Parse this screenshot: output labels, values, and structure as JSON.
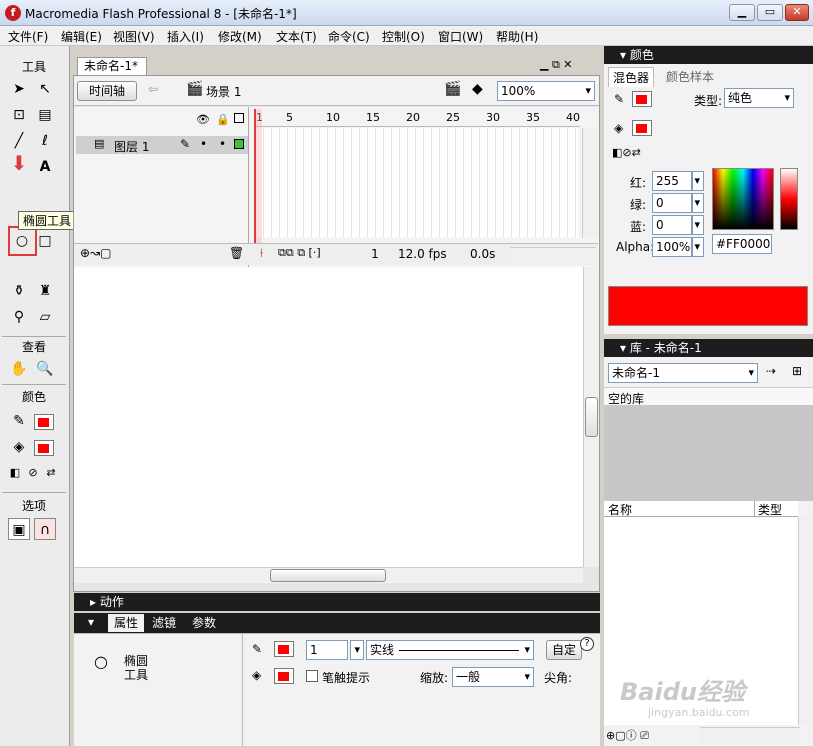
{
  "window": {
    "title": "Macromedia Flash Professional 8 - [未命名-1*]",
    "app_icon": "f",
    "min": "▁",
    "max": "▭",
    "close": "✕"
  },
  "menu": [
    "文件(F)",
    "编辑(E)",
    "视图(V)",
    "插入(I)",
    "修改(M)",
    "文本(T)",
    "命令(C)",
    "控制(O)",
    "窗口(W)",
    "帮助(H)"
  ],
  "toolbox": {
    "title": "工具",
    "view": "查看",
    "colors": "颜色",
    "options": "选项",
    "tooltip": "椭圆工具 (O)"
  },
  "document": {
    "tab": "未命名-1*",
    "timeline_btn": "时间轴",
    "scene": "场景 1",
    "zoom": "100%"
  },
  "timeline": {
    "frame_numbers": [
      "1",
      "5",
      "10",
      "15",
      "20",
      "25",
      "30",
      "35",
      "40"
    ],
    "layer_name": "图层 1",
    "current_frame": "1",
    "fps": "12.0 fps",
    "time": "0.0s"
  },
  "actions_panel": {
    "title": "动作"
  },
  "properties": {
    "tabs": [
      "属性",
      "滤镜",
      "参数"
    ],
    "tool_name_line1": "椭圆",
    "tool_name_line2": "工具",
    "stroke_width": "1",
    "stroke_style": "实线",
    "custom_btn": "自定",
    "hinting": "笔触提示",
    "scale_label": "缩放:",
    "scale_value": "一般",
    "corner_label": "尖角:",
    "help": "?"
  },
  "color_panel": {
    "title": "颜色",
    "tabs": [
      "混色器",
      "颜色样本"
    ],
    "type_label": "类型:",
    "type_value": "纯色",
    "red_label": "红:",
    "red": "255",
    "green_label": "绿:",
    "green": "0",
    "blue_label": "蓝:",
    "blue": "0",
    "alpha_label": "Alpha:",
    "alpha": "100%",
    "hex": "#FF0000",
    "current_color": "#FF0000"
  },
  "library_panel": {
    "title": "库 - 未命名-1",
    "doc_select": "未命名-1",
    "empty_text": "空的库",
    "col_name": "名称",
    "col_type": "类型"
  },
  "watermark": {
    "line1": "Baidu经验",
    "line2": "jingyan.baidu.com"
  }
}
